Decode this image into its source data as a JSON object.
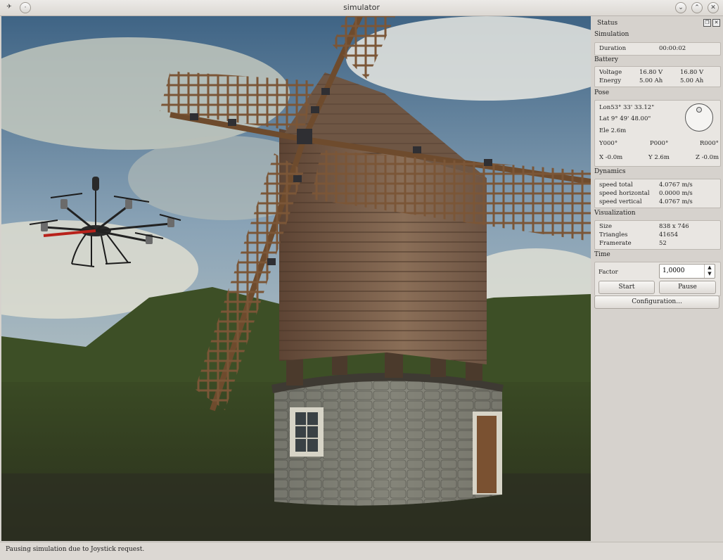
{
  "window": {
    "title": "simulator"
  },
  "panel": {
    "title": "Status",
    "simulation": {
      "label": "Simulation",
      "duration_label": "Duration",
      "duration_value": "00:00:02"
    },
    "battery": {
      "label": "Battery",
      "voltage_label": "Voltage",
      "voltage_1": "16.80 V",
      "voltage_2": "16.80 V",
      "energy_label": "Energy",
      "energy_1": "5.00 Ah",
      "energy_2": "5.00 Ah"
    },
    "pose": {
      "label": "Pose",
      "lon": "Lon53° 33' 33.12\"",
      "lat": "Lat 9° 49' 48.00\"",
      "ele": "Ele 2.6m",
      "yaw": "Y000°",
      "pitch": "P000°",
      "roll": "R000°",
      "x": "X -0.0m",
      "y": "Y 2.6m",
      "z": "Z -0.0m"
    },
    "dynamics": {
      "label": "Dynamics",
      "rows": [
        {
          "name": "speed total",
          "value": "4.0767 m/s"
        },
        {
          "name": "speed horizontal",
          "value": "0.0000 m/s"
        },
        {
          "name": "speed vertical",
          "value": "4.0767 m/s"
        }
      ]
    },
    "visualization": {
      "label": "Visualization",
      "rows": [
        {
          "name": "Size",
          "value": "838 x 746"
        },
        {
          "name": "Triangles",
          "value": "41654"
        },
        {
          "name": "Framerate",
          "value": "52"
        }
      ]
    },
    "time": {
      "label": "Time",
      "factor_label": "Factor",
      "factor_value": "1,0000",
      "start_label": "Start",
      "pause_label": "Pause"
    },
    "config_label": "Configuration..."
  },
  "statusbar": {
    "message": "Pausing simulation due to Joystick request."
  }
}
